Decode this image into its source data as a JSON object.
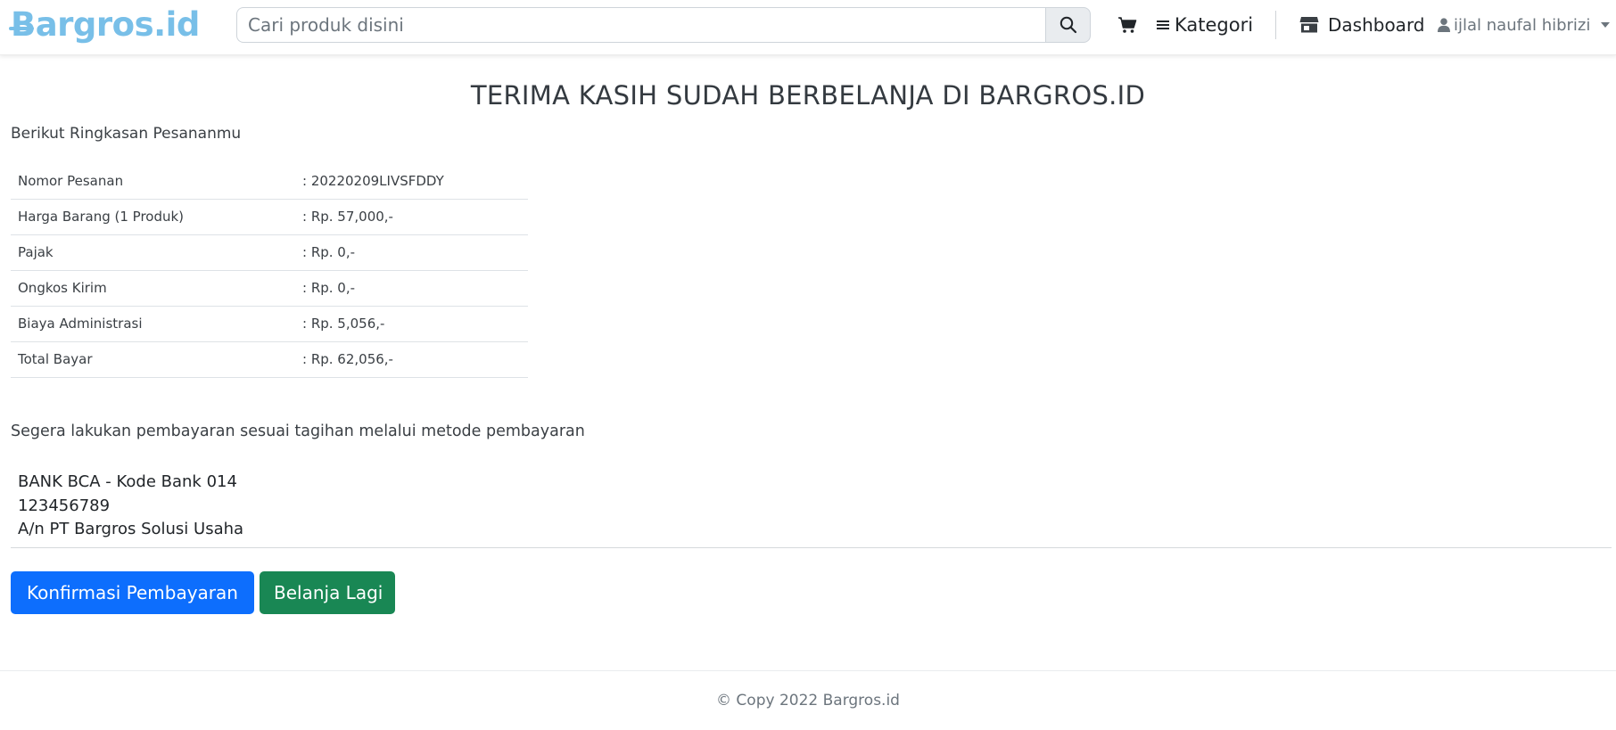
{
  "header": {
    "brand": "Bargros.id",
    "search": {
      "placeholder": "Cari produk disini",
      "value": ""
    },
    "nav": {
      "kategori_label": "Kategori",
      "dashboard_label": "Dashboard",
      "user_name": "ijlal naufal hibrizi"
    },
    "icons": {
      "search": "search-icon",
      "cart": "cart-icon",
      "menu": "hamburger-icon",
      "store": "store-icon",
      "user": "user-icon",
      "caret": "caret-down-icon"
    }
  },
  "main": {
    "title": "TERIMA KASIH SUDAH BERBELANJA DI BARGROS.ID",
    "subtitle": "Berikut Ringkasan Pesananmu",
    "summary": [
      {
        "label": "Nomor Pesanan",
        "value": ": 20220209LIVSFDDY"
      },
      {
        "label": "Harga Barang (1 Produk)",
        "value": ": Rp. 57,000,-"
      },
      {
        "label": "Pajak",
        "value": ": Rp. 0,-"
      },
      {
        "label": "Ongkos Kirim",
        "value": ": Rp. 0,-"
      },
      {
        "label": "Biaya Administrasi",
        "value": ": Rp. 5,056,-"
      },
      {
        "label": "Total Bayar",
        "value": ": Rp. 62,056,-"
      }
    ],
    "payment_note": "Segera lakukan pembayaran sesuai tagihan melalui metode pembayaran",
    "bank": {
      "name": "BANK BCA - Kode Bank 014",
      "account_number": "123456789",
      "account_holder": "A/n PT Bargros Solusi Usaha"
    },
    "buttons": {
      "confirm_label": "Konfirmasi Pembayaran",
      "shop_again_label": "Belanja Lagi"
    }
  },
  "footer": {
    "copyright": "© Copy 2022 Bargros.id"
  },
  "colors": {
    "brand": "#78bfe8",
    "primary": "#0d6efd",
    "success": "#198754"
  }
}
